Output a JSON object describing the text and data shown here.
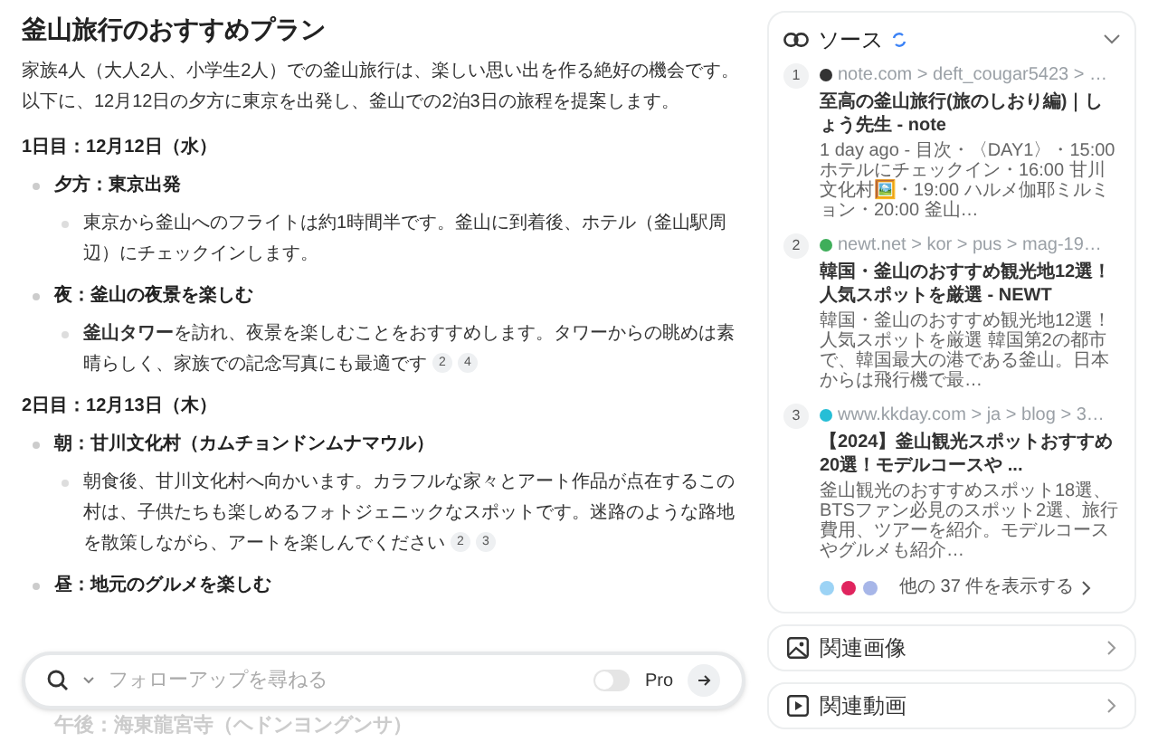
{
  "title": "釜山旅行のおすすめプラン",
  "intro": "家族4人（大人2人、小学生2人）での釜山旅行は、楽しい思い出を作る絶好の機会です。以下に、12月12日の夕方に東京を出発し、釜山での2泊3日の旅程を提案します。",
  "days": [
    {
      "heading": "1日目：12月12日（水）",
      "items": [
        {
          "label": "夕方：東京出発",
          "details": [
            {
              "text": "東京から釜山へのフライトは約1時間半です。釜山に到着後、ホテル（釜山駅周辺）にチェックインします。"
            }
          ]
        },
        {
          "label": "夜：釜山の夜景を楽しむ",
          "details": [
            {
              "text": "**釜山タワー**を訪れ、夜景を楽しむことをおすすめします。タワーからの眺めは素晴らしく、家族での記念写真にも最適です",
              "citations": [
                "2",
                "4"
              ]
            }
          ]
        }
      ]
    },
    {
      "heading": "2日目：12月13日（木）",
      "items": [
        {
          "label": "朝：甘川文化村（カムチョンドンムナマウル）",
          "details": [
            {
              "text": "朝食後、甘川文化村へ向かいます。カラフルな家々とアート作品が点在するこの村は、子供たちも楽しめるフォトジェニックなスポットです。迷路のような路地を散策しながら、アートを楽しんでください",
              "citations": [
                "2",
                "3"
              ]
            }
          ]
        },
        {
          "label": "昼：地元のグルメを楽しむ"
        }
      ]
    }
  ],
  "faded_line": "午後：海東龍宮寺（ヘドンヨングンサ）",
  "search": {
    "placeholder": "フォローアップを尋ねる",
    "pro_label": "Pro",
    "pro_on": false
  },
  "sources": {
    "title": "ソース",
    "items": [
      {
        "number": "1",
        "url": "note.com > deft_cougar5423 > …",
        "title": "至高の釜山旅行(旅のしおり編)｜しょう先生 - note",
        "snippet": "1 day ago - 目次・〈DAY1〉・15:00 ホテルにチェックイン・16:00 甘川文化村🖼️・19:00 ハルメ伽耶ミルミョン・20:00 釜山…",
        "color": "#333333"
      },
      {
        "number": "2",
        "url": "newt.net > kor > pus > mag-19…",
        "title": "韓国・釜山のおすすめ観光地12選！人気スポットを厳選 - NEWT",
        "snippet": "韓国・釜山のおすすめ観光地12選！人気スポットを厳選 韓国第2の都市で、韓国最大の港である釜山。日本からは飛行機で最…",
        "color": "#3fae5a"
      },
      {
        "number": "3",
        "url": "www.kkday.com > ja > blog > 3…",
        "title": "【2024】釜山観光スポットおすすめ20選！モデルコースや ...",
        "snippet": "釜山観光のおすすめスポット18選、BTSファン必見のスポット2選、旅行費用、ツアーを紹介。モデルコースやグルメも紹介…",
        "color": "#26bed6"
      }
    ],
    "more": "他の 37 件を表示する"
  },
  "panels": [
    {
      "kind": "images",
      "label": "関連画像"
    },
    {
      "kind": "videos",
      "label": "関連動画"
    }
  ]
}
